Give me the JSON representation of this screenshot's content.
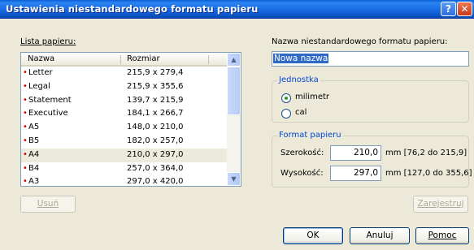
{
  "window": {
    "title": "Ustawienia niestandardowego formatu papieru",
    "help_glyph": "?",
    "close_glyph": "✕"
  },
  "list": {
    "label": "Lista papieru:",
    "col_name": "Nazwa",
    "col_size": "Rozmiar",
    "items": [
      {
        "name": "Letter",
        "size": "215,9 x 279,4"
      },
      {
        "name": "Legal",
        "size": "215,9 x 355,6"
      },
      {
        "name": "Statement",
        "size": "139,7 x 215,9"
      },
      {
        "name": "Executive",
        "size": "184,1 x 266,7"
      },
      {
        "name": "A5",
        "size": "148,0 x 210,0"
      },
      {
        "name": "B5",
        "size": "182,0 x 257,0"
      },
      {
        "name": "A4",
        "size": "210,0 x 297,0"
      },
      {
        "name": "B4",
        "size": "257,0 x 364,0"
      },
      {
        "name": "A3",
        "size": "297,0 x 420,0"
      }
    ],
    "bullet": "•",
    "scroll_up": "▲",
    "scroll_down": "▼"
  },
  "delete_button": "Usuń",
  "custom_name": {
    "label": "Nazwa niestandardowego formatu papieru:",
    "value": "Nowa nazwa"
  },
  "unit": {
    "legend": "Jednostka",
    "options": [
      "milimetr",
      "cal"
    ],
    "selected": "milimetr"
  },
  "paper_format": {
    "legend": "Format papieru",
    "width_label": "Szerokość:",
    "width_value": "210,0",
    "width_range": "mm [76,2 do 215,9]",
    "height_label": "Wysokość:",
    "height_value": "297,0",
    "height_range": "mm [127,0 do 355,6]"
  },
  "register_button": "Zarejestruj",
  "ok_button": "OK",
  "cancel_button": "Anuluj",
  "help_button": "Pomoc"
}
